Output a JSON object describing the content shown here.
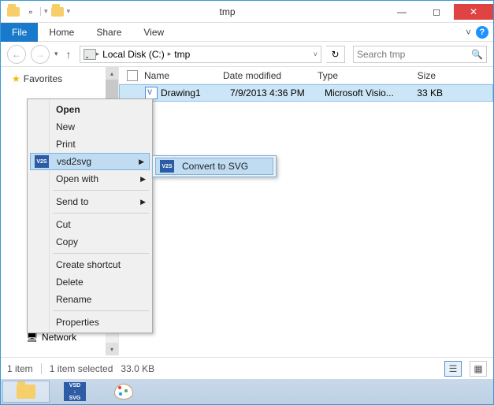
{
  "titlebar": {
    "title": "tmp"
  },
  "ribbon": {
    "file": "File",
    "tabs": [
      "Home",
      "Share",
      "View"
    ]
  },
  "nav": {
    "segments": [
      "Local Disk (C:)",
      "tmp"
    ],
    "search_placeholder": "Search tmp"
  },
  "sidebar": {
    "favorites": "Favorites",
    "network": "Network"
  },
  "columns": {
    "name": "Name",
    "date": "Date modified",
    "type": "Type",
    "size": "Size"
  },
  "file_row": {
    "name": "Drawing1",
    "date": "7/9/2013 4:36 PM",
    "type": "Microsoft Visio...",
    "size": "33 KB"
  },
  "context_menu": {
    "open": "Open",
    "new": "New",
    "print": "Print",
    "vsd2svg": "vsd2svg",
    "open_with": "Open with",
    "send_to": "Send to",
    "cut": "Cut",
    "copy": "Copy",
    "create_shortcut": "Create shortcut",
    "delete": "Delete",
    "rename": "Rename",
    "properties": "Properties"
  },
  "submenu": {
    "convert": "Convert to SVG"
  },
  "status": {
    "count": "1 item",
    "selected": "1 item selected",
    "size": "33.0 KB"
  },
  "taskbar": {
    "vsd_label": "VSD\n↓\nSVG"
  }
}
